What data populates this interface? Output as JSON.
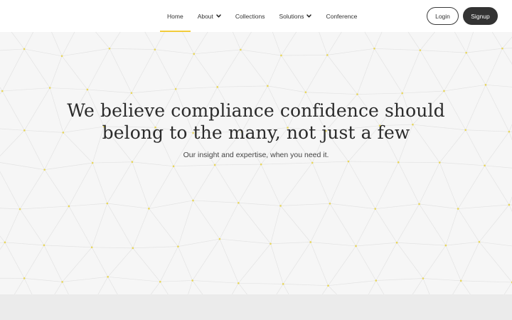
{
  "nav": {
    "items": [
      {
        "label": "Home",
        "active": true,
        "dropdown": false
      },
      {
        "label": "About",
        "active": false,
        "dropdown": true
      },
      {
        "label": "Collections",
        "active": false,
        "dropdown": false
      },
      {
        "label": "Solutions",
        "active": false,
        "dropdown": true
      },
      {
        "label": "Conference",
        "active": false,
        "dropdown": false
      }
    ]
  },
  "auth": {
    "login_label": "Login",
    "signup_label": "Signup"
  },
  "hero": {
    "title_line1": "We believe compliance confidence should",
    "title_line2": "belong to the many, not just a few",
    "subtitle": "Our insight and expertise, when you need it."
  },
  "colors": {
    "accent": "#f2cc3b",
    "hero_background": "#f6f6f6",
    "band_background": "#ebebeb",
    "signup_background": "#333333",
    "pattern_line": "#e3e3e3",
    "pattern_dot": "#e8d65a"
  },
  "icons": {
    "dropdown": "chevron-down-icon"
  }
}
